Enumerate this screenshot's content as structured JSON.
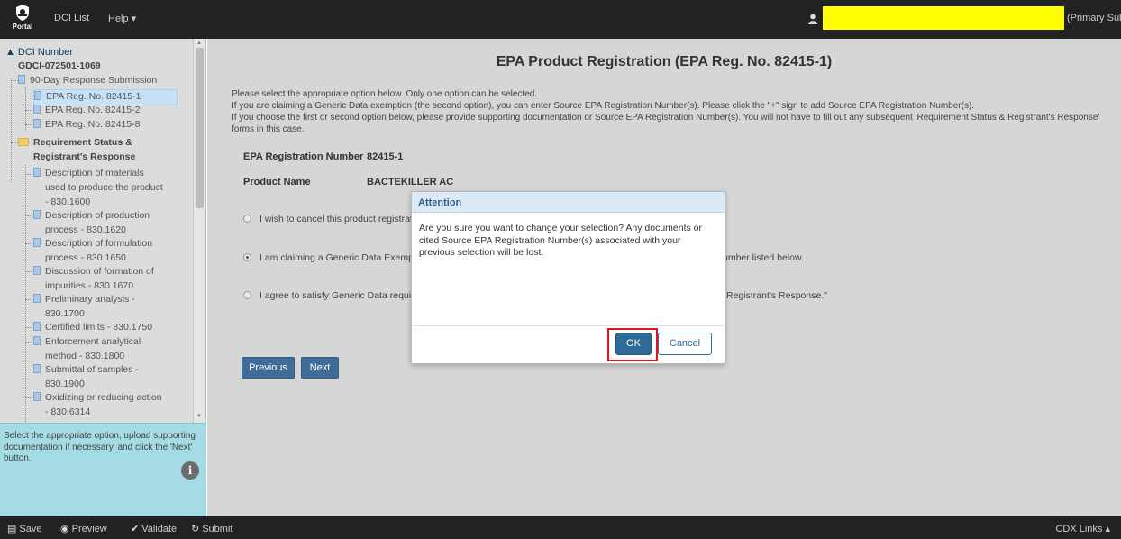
{
  "topbar": {
    "logo_label": "Portal",
    "nav": [
      {
        "label": "DCI List"
      },
      {
        "label": "Help ▾"
      }
    ],
    "user_role": "(Primary Submitter)"
  },
  "sidebar": {
    "root": {
      "label": "DCI Number",
      "sub": "GDCI-072501-1069"
    },
    "tree": {
      "response_submission": "90-Day Response Submission",
      "reg_items": [
        "EPA Reg. No. 82415-1",
        "EPA Reg. No. 82415-2",
        "EPA Reg. No. 82415-8"
      ],
      "requirement_folder": [
        "Requirement Status &",
        "Registrant's Response"
      ],
      "requirements": [
        [
          "Description of materials",
          "used to produce the product",
          "- 830.1600"
        ],
        [
          "Description of production",
          "process - 830.1620"
        ],
        [
          "Description of formulation",
          "process - 830.1650"
        ],
        [
          "Discussion of formation of",
          "impurities - 830.1670"
        ],
        [
          "Preliminary analysis -",
          "830.1700"
        ],
        [
          "Certified limits - 830.1750"
        ],
        [
          "Enforcement analytical",
          "method - 830.1800"
        ],
        [
          "Submittal of samples -",
          "830.1900"
        ],
        [
          "Oxidizing or reducing action",
          "- 830.6314"
        ]
      ]
    },
    "help_text": "Select the appropriate option, upload supporting documentation if necessary, and click the 'Next' button.",
    "info_icon_glyph": "i"
  },
  "main": {
    "title": "EPA Product Registration (EPA Reg. No. 82415-1)",
    "intro_lines": [
      "Please select the appropriate option below. Only one option can be selected.",
      "If you are claiming a Generic Data exemption (the second option), you can enter Source EPA Registration Number(s). Please click the \"+\" sign to add Source EPA Registration Number(s).",
      "If you choose the first or second option below, please provide supporting documentation or Source EPA Registration Number(s). You will not have to fill out any subsequent 'Requirement Status & Registrant's Response' forms in this case."
    ],
    "reg_number_label": "EPA Registration Number",
    "reg_number_value": "82415-1",
    "product_name_label": "Product Name",
    "product_name_value": "BACTEKILLER AC",
    "options": [
      {
        "text": "I wish to cancel this product registrat",
        "tail": "",
        "selected": false
      },
      {
        "text": "I am claiming a Generic Data Exemp",
        "tail": "umber listed below.",
        "selected": true
      },
      {
        "text": "I agree to satisfy Generic Data requi",
        "tail": "Registrant's Response.\"",
        "selected": false
      }
    ],
    "previous_label": "Previous",
    "next_label": "Next"
  },
  "modal": {
    "title": "Attention",
    "body": "Are you sure you want to change your selection? Any documents or cited Source EPA Registration Number(s) associated with your previous selection will be lost.",
    "ok_label": "OK",
    "cancel_label": "Cancel"
  },
  "bottombar": {
    "save": "Save",
    "preview": "Preview",
    "validate": "Validate",
    "submit": "Submit",
    "cdx_links": "CDX Links ▴"
  },
  "colors": {
    "topbar": "#222222",
    "highlight_yellow": "#ffff00",
    "help_panel": "#a4dbe4",
    "primary_button": "#3f6d98",
    "ok_highlight_border": "#e3141b"
  }
}
